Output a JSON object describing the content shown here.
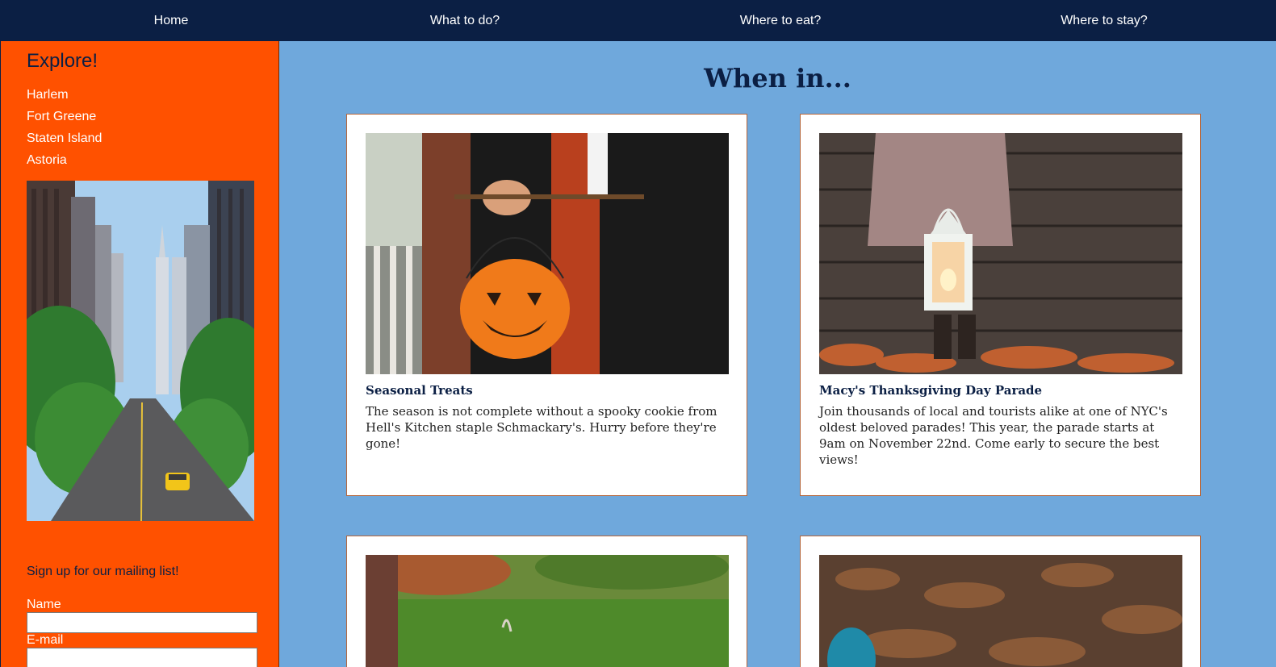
{
  "nav": {
    "items": [
      {
        "label": "Home"
      },
      {
        "label": "What to do?"
      },
      {
        "label": "Where to eat?"
      },
      {
        "label": "Where to stay?"
      }
    ]
  },
  "sidebar": {
    "title": "Explore!",
    "links": [
      {
        "label": "Harlem"
      },
      {
        "label": "Fort Greene"
      },
      {
        "label": "Staten Island"
      },
      {
        "label": "Astoria"
      }
    ],
    "photo": "city-street-photo",
    "signup": {
      "heading": "Sign up for our mailing list!",
      "name_label": "Name",
      "name_value": "",
      "email_label": "E-mail",
      "email_value": ""
    }
  },
  "main": {
    "title": "When in...",
    "cards": [
      {
        "photo": "halloween-pumpkin-bucket-photo",
        "title": "Seasonal Treats",
        "text": "The season is not complete without a spooky cookie from Hell's Kitchen staple Schmackary's. Hurry before they're gone!"
      },
      {
        "photo": "lantern-autumn-leaves-photo",
        "title": "Macy's Thanksgiving Day Parade",
        "text": "Join thousands of local and tourists alike at one of NYC's oldest beloved parades! This year, the parade starts at 9am on November 22nd. Come early to secure the best views!"
      },
      {
        "photo": "park-grass-photo",
        "title": "",
        "text": ""
      },
      {
        "photo": "fallen-leaves-photo",
        "title": "",
        "text": ""
      }
    ]
  },
  "colors": {
    "nav_bg": "#0b1f44",
    "sidebar_bg": "#ff5100",
    "page_bg": "#6fa8dc",
    "card_border": "#b5653a"
  }
}
